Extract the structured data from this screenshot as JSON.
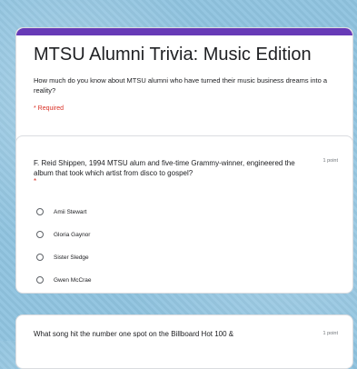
{
  "form": {
    "title": "MTSU Alumni Trivia: Music Edition",
    "description": "How much do you know about MTSU alumni who have turned their music business dreams into a reality?",
    "required_note": "* Required",
    "accent_color": "#673ab7"
  },
  "questions": [
    {
      "text": "F. Reid Shippen, 1994 MTSU alum and five-time Grammy-winner, engineered the album that took which artist from disco to gospel?",
      "points": "1 point",
      "required_marker": "*",
      "options": [
        "Amii Stewart",
        "Gloria Gaynor",
        "Sister Sledge",
        "Gwen McCrae"
      ]
    },
    {
      "text": "What song hit the number one spot on the Billboard Hot 100 &",
      "points": "1 point"
    }
  ]
}
